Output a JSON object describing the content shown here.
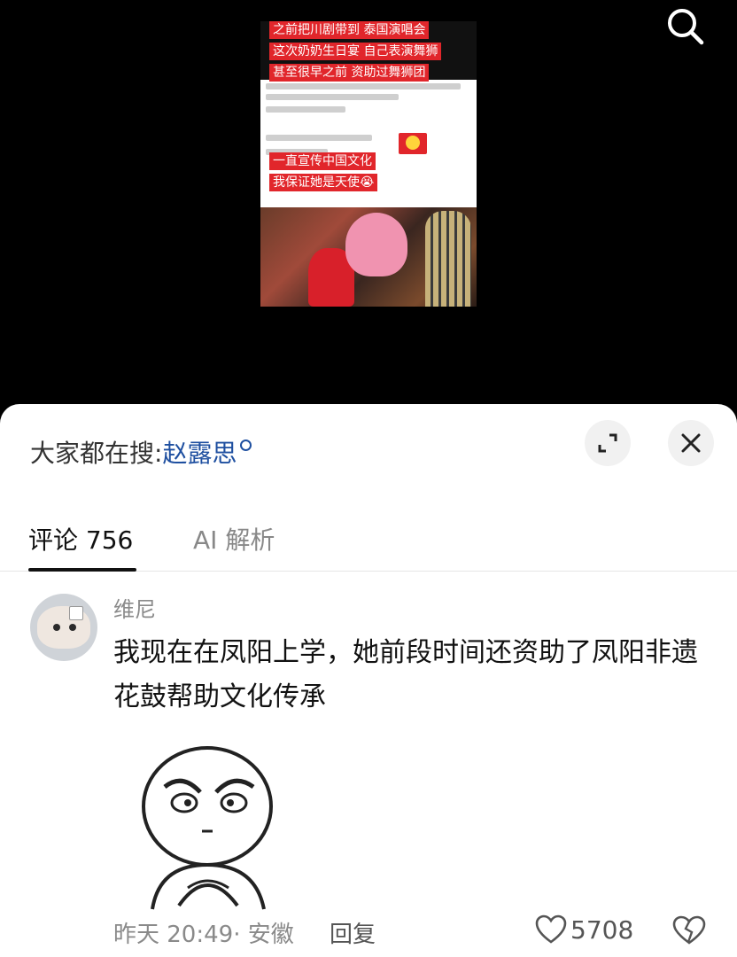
{
  "video": {
    "captions": [
      "之前把川剧带到 泰国演唱会",
      "这次奶奶生日宴 自己表演舞狮",
      "甚至很早之前 资助过舞狮团",
      "一直宣传中国文化",
      "我保证她是天使😭"
    ]
  },
  "trending": {
    "prefix": "大家都在搜:",
    "keyword": "赵露思"
  },
  "tabs": [
    {
      "label": "评论 756",
      "active": true
    },
    {
      "label": "AI 解析",
      "active": false
    }
  ],
  "comment": {
    "author": "维尼",
    "text": "我现在在凤阳上学，她前段时间还资助了凤阳非遗花鼓帮助文化传承",
    "meta": "昨天 20:49· 安徽",
    "reply_label": "回复",
    "like_count": "5708"
  },
  "icons": {
    "search": "search-icon",
    "expand": "expand-icon",
    "close": "close-icon",
    "like": "heart-icon",
    "dislike": "broken-heart-icon"
  },
  "colors": {
    "caption_bg": "#e1262b",
    "keyword": "#1e4fa0"
  }
}
